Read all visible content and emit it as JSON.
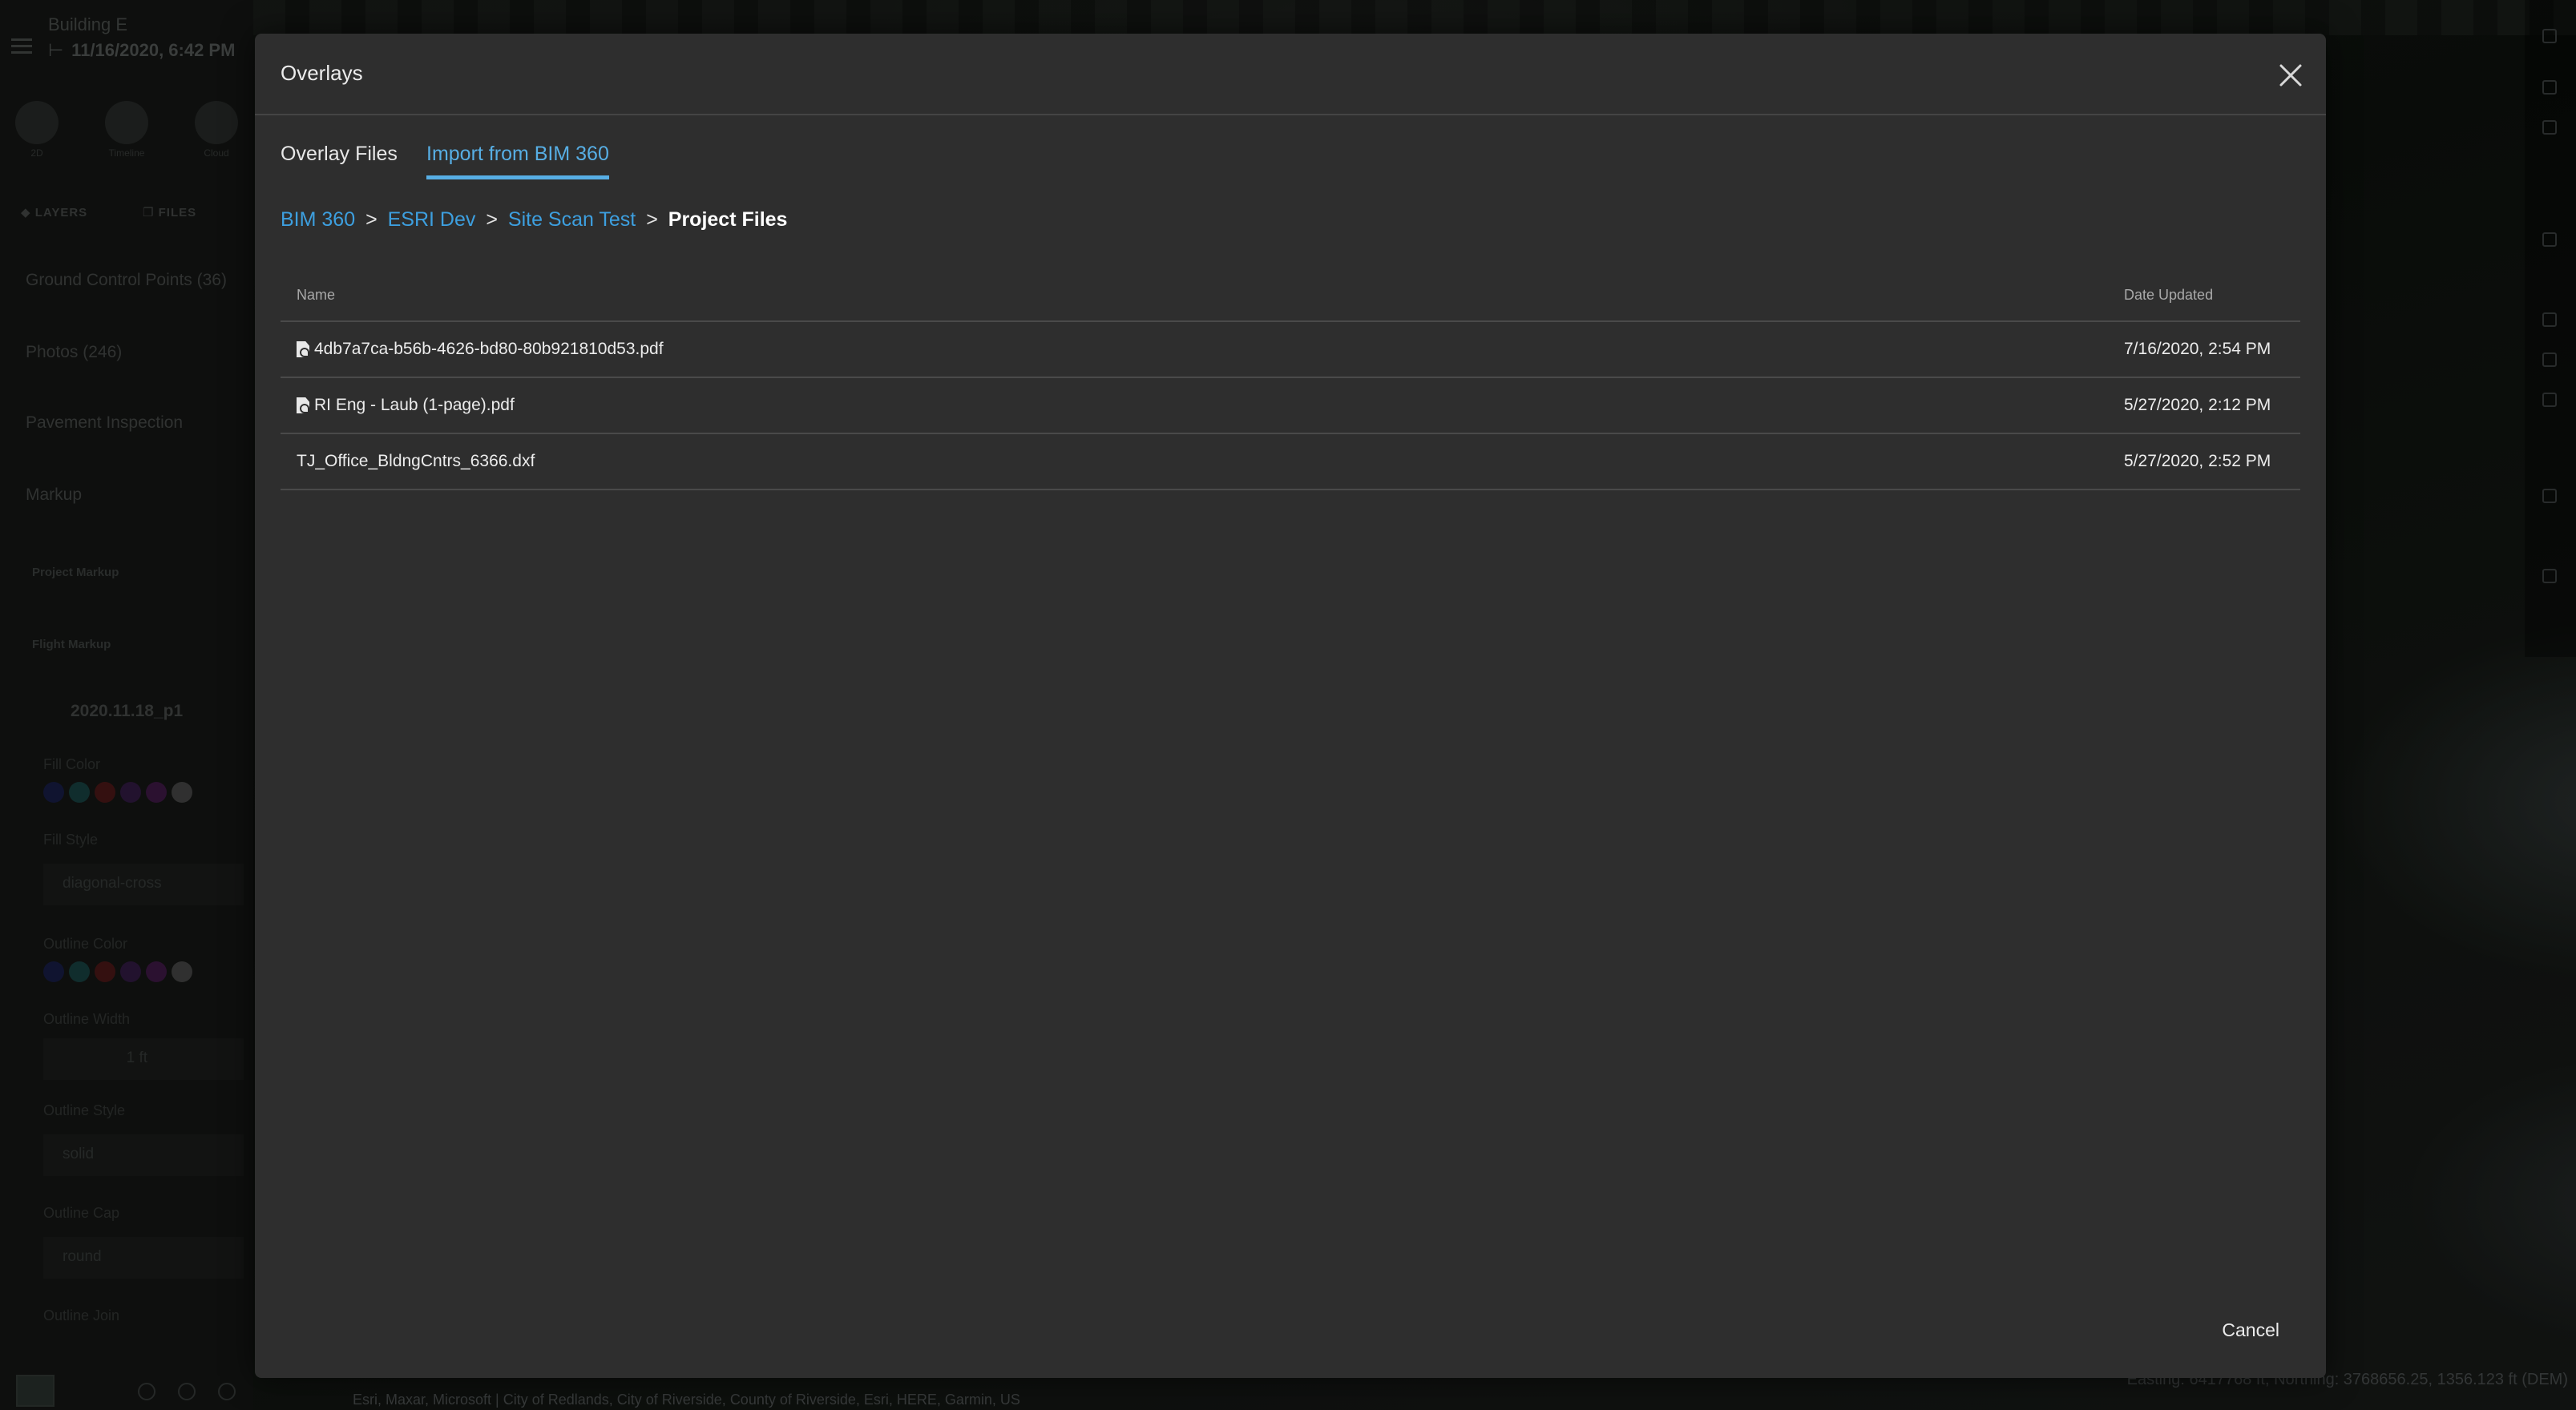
{
  "sidebar": {
    "title": "Building E",
    "date": "11/16/2020, 6:42 PM",
    "modes": [
      {
        "label": "2D"
      },
      {
        "label": "Timeline"
      },
      {
        "label": "Cloud"
      }
    ],
    "tabs": {
      "layers": "LAYERS",
      "files": "FILES"
    },
    "items": {
      "gcp": "Ground Control Points (36)",
      "photos": "Photos (246)",
      "pavement": "Pavement Inspection",
      "markup": "Markup",
      "project_markup": "Project Markup",
      "flight_markup": "Flight Markup",
      "flight": "2020.11.18_p1"
    },
    "props": {
      "fill_color": "Fill Color",
      "fill_style": "Fill Style",
      "fill_style_value": "diagonal-cross",
      "outline_color": "Outline Color",
      "outline_width": "Outline Width",
      "outline_width_value": "1 ft",
      "outline_style": "Outline Style",
      "outline_style_value": "solid",
      "outline_cap": "Outline Cap",
      "outline_cap_value": "round",
      "outline_join": "Outline Join"
    },
    "swatch_colors": [
      "#1c2a8a",
      "#1f7f80",
      "#9a1c1c",
      "#5b2185",
      "#7a1f8c",
      "#8a8a8a"
    ]
  },
  "map": {
    "attribution": "Esri, Maxar, Microsoft | City of Redlands, City of Riverside, County of Riverside, Esri, HERE, Garmin, US",
    "coords": "Easting: 6417768 ft, Northing: 3768656.25, 1356.123 ft (DEM)"
  },
  "modal": {
    "title": "Overlays",
    "close_icon": "close-icon",
    "tabs": {
      "overlay_files": "Overlay Files",
      "import_bim": "Import from BIM 360"
    },
    "breadcrumb": {
      "c1": "BIM 360",
      "c2": "ESRI Dev",
      "c3": "Site Scan Test",
      "sep": ">",
      "current": "Project Files"
    },
    "table": {
      "col_name": "Name",
      "col_date": "Date Updated",
      "rows": [
        {
          "name": "4db7a7ca-b56b-4626-bd80-80b921810d53.pdf",
          "date": "7/16/2020, 2:54 PM",
          "icon": "pdf-file-icon"
        },
        {
          "name": "RI Eng - Laub (1-page).pdf",
          "date": "5/27/2020, 2:12 PM",
          "icon": "pdf-file-icon"
        },
        {
          "name": "TJ_Office_BldngCntrs_6366.dxf",
          "date": "5/27/2020, 2:52 PM",
          "icon": ""
        }
      ]
    },
    "cancel_label": "Cancel"
  },
  "colors": {
    "accent": "#3d9fdf",
    "tab_active": "#57aee4",
    "modal_bg": "#2e2e2e"
  }
}
